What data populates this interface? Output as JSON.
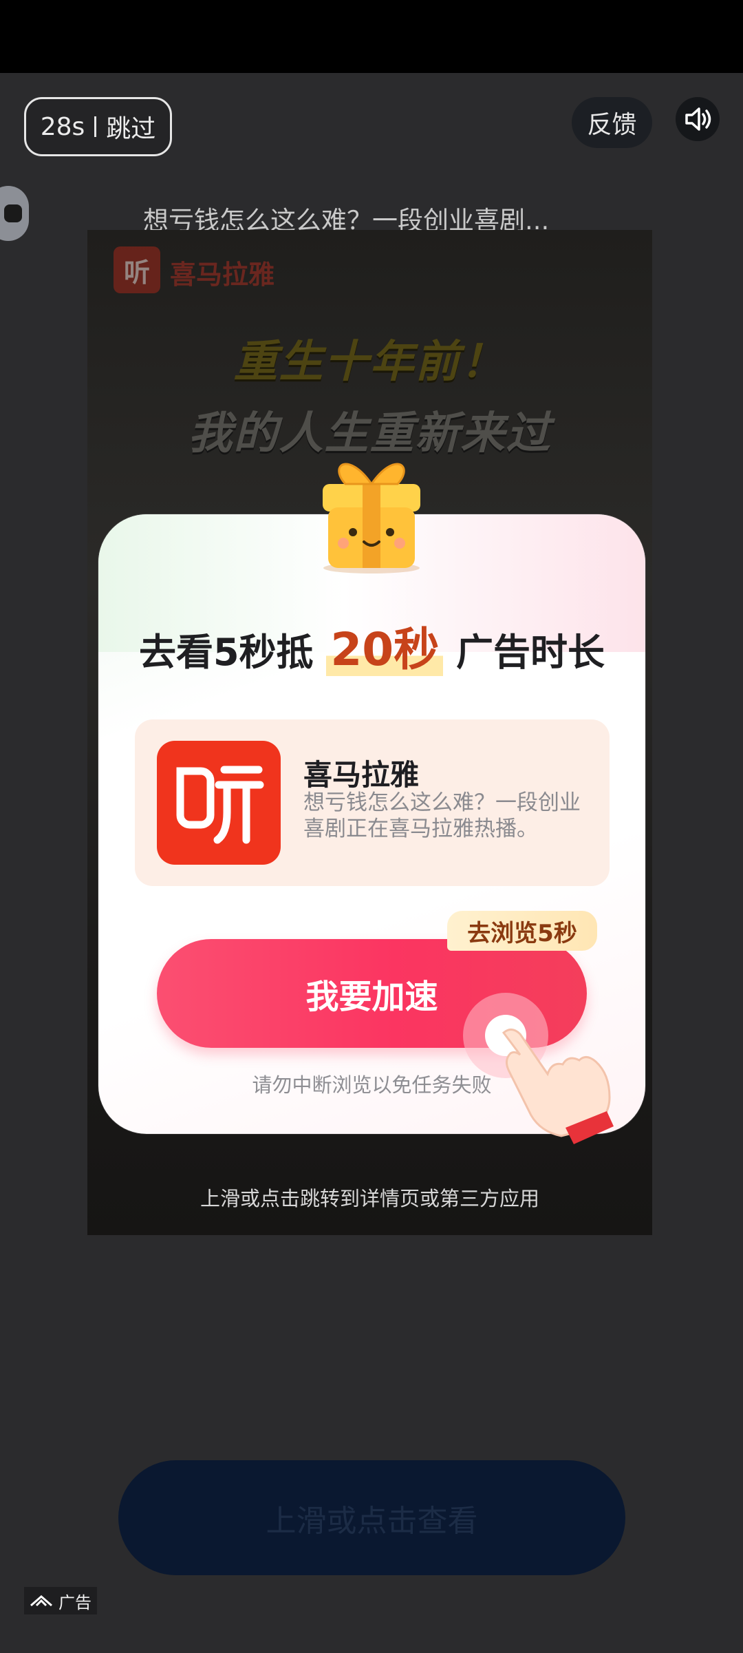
{
  "top_bar": {
    "countdown": "28s",
    "skip_label": "跳过",
    "feedback_label": "反馈"
  },
  "headline": "想亏钱怎么这么难？一段创业喜剧...",
  "video": {
    "logo_text": "喜马拉雅",
    "title_line1": "重生十年前！",
    "title_line2": "我的人生重新来过",
    "caption": "上滑或点击跳转到详情页或第三方应用"
  },
  "modal": {
    "title_prefix": "去看5秒抵",
    "title_highlight": "20秒",
    "title_suffix": "广告时长",
    "app_name": "喜马拉雅",
    "app_desc": "想亏钱怎么这么难？一段创业喜剧正在喜马拉雅热播。",
    "badge": "去浏览5秒",
    "cta_label": "我要加速",
    "hint": "请勿中断浏览以免任务失败"
  },
  "bottom_cta": "上滑或点击查看",
  "ad_tag": "广告",
  "colors": {
    "cta_pink": "#fb3561",
    "app_red": "#f0341d",
    "highlight_orange": "#c7431a",
    "bottom_button": "#0a1830"
  }
}
